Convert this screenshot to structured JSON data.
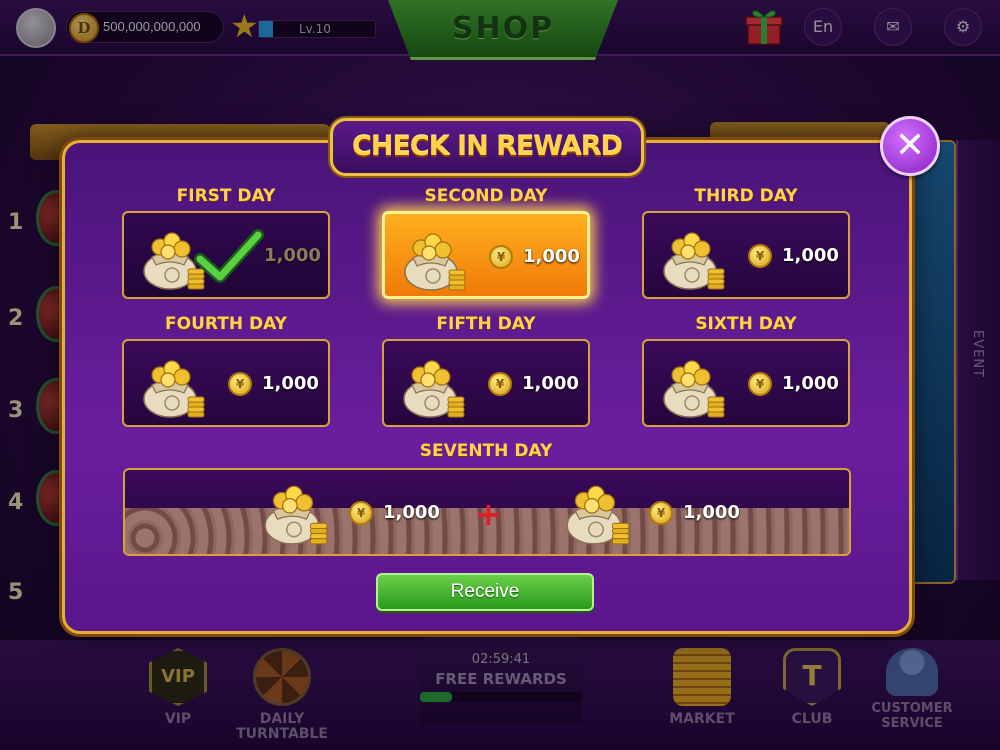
{
  "top_bar": {
    "coin_icon_letter": "D",
    "coin_balance": "500,000,000,000",
    "level": "Lv.10",
    "level_progress": 0.12,
    "shop_label": "SHOP",
    "language": "En"
  },
  "side_ranks": [
    "1",
    "2",
    "3",
    "4",
    "5"
  ],
  "event_tab": "EVENT",
  "modal": {
    "title": "CHECK IN REWARD",
    "close_symbol": "✕",
    "coin_symbol": "¥",
    "days": [
      {
        "label": "FIRST DAY",
        "amount": "1,000",
        "state": "claimed"
      },
      {
        "label": "SECOND DAY",
        "amount": "1,000",
        "state": "active"
      },
      {
        "label": "THIRD DAY",
        "amount": "1,000",
        "state": "locked"
      },
      {
        "label": "FOURTH DAY",
        "amount": "1,000",
        "state": "locked"
      },
      {
        "label": "FIFTH DAY",
        "amount": "1,000",
        "state": "locked"
      },
      {
        "label": "SIXTH DAY",
        "amount": "1,000",
        "state": "locked"
      }
    ],
    "seventh_day": {
      "label": "SEVENTH DAY",
      "amount_a": "1,000",
      "amount_b": "1,000",
      "plus": "+"
    },
    "receive_label": "Receive"
  },
  "bottom_bar": {
    "vip_label": "VIP",
    "vip_badge": "VIP",
    "turntable_label_1": "DAILY",
    "turntable_label_2": "TURNTABLE",
    "free_timer": "02:59:41",
    "free_label": "FREE REWARDS",
    "free_progress": 0.2,
    "market_label": "MARKET",
    "club_label": "CLUB",
    "club_badge": "T",
    "service_label_1": "CUSTOMER",
    "service_label_2": "SERVICE"
  },
  "colors": {
    "accent_gold": "#ffd24a",
    "modal_purple": "#6a1e9e",
    "receive_green": "#2a9a1e",
    "active_orange": "#f07a08"
  }
}
